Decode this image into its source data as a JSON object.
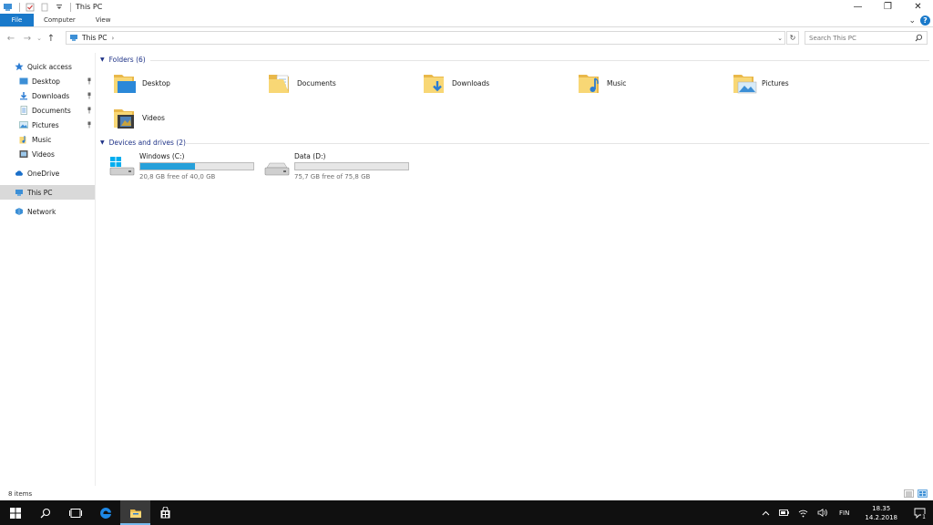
{
  "window": {
    "title": "This PC",
    "controls": {
      "minimize": "—",
      "maximize": "❐",
      "close": "✕"
    }
  },
  "ribbon": {
    "tabs": [
      "File",
      "Computer",
      "View"
    ],
    "expand_glyph": "⌄",
    "help_label": "?"
  },
  "navigation": {
    "back_glyph": "←",
    "forward_glyph": "→",
    "recent_glyph": "⌄",
    "up_glyph": "↑",
    "breadcrumb": "This PC",
    "breadcrumb_chevron": "›",
    "dropdown_glyph": "⌄",
    "refresh_glyph": "↻",
    "search_placeholder": "Search This PC"
  },
  "sidebar": {
    "quick_access": "Quick access",
    "pinned": [
      "Desktop",
      "Downloads",
      "Documents",
      "Pictures"
    ],
    "recent": [
      "Music",
      "Videos"
    ],
    "onedrive": "OneDrive",
    "this_pc": "This PC",
    "network": "Network"
  },
  "content": {
    "folders_header": "Folders (6)",
    "folders": [
      "Desktop",
      "Documents",
      "Downloads",
      "Music",
      "Pictures",
      "Videos"
    ],
    "devices_header": "Devices and drives (2)",
    "drives": [
      {
        "name": "Windows (C:)",
        "free": "20,8 GB free of 40,0 GB",
        "used_fraction": 0.48
      },
      {
        "name": "Data (D:)",
        "free": "75,7 GB free of 75,8 GB",
        "used_fraction": 0.0
      }
    ]
  },
  "status": {
    "item_count": "8 items"
  },
  "taskbar": {
    "language": "FIN",
    "time": "18.35",
    "date": "14.2.2018",
    "notification_count": "1"
  },
  "colors": {
    "accent": "#1979ca",
    "drive_bar": "#26a0da",
    "group_header": "#1e3287",
    "folder_yellow": "#f8d775"
  }
}
